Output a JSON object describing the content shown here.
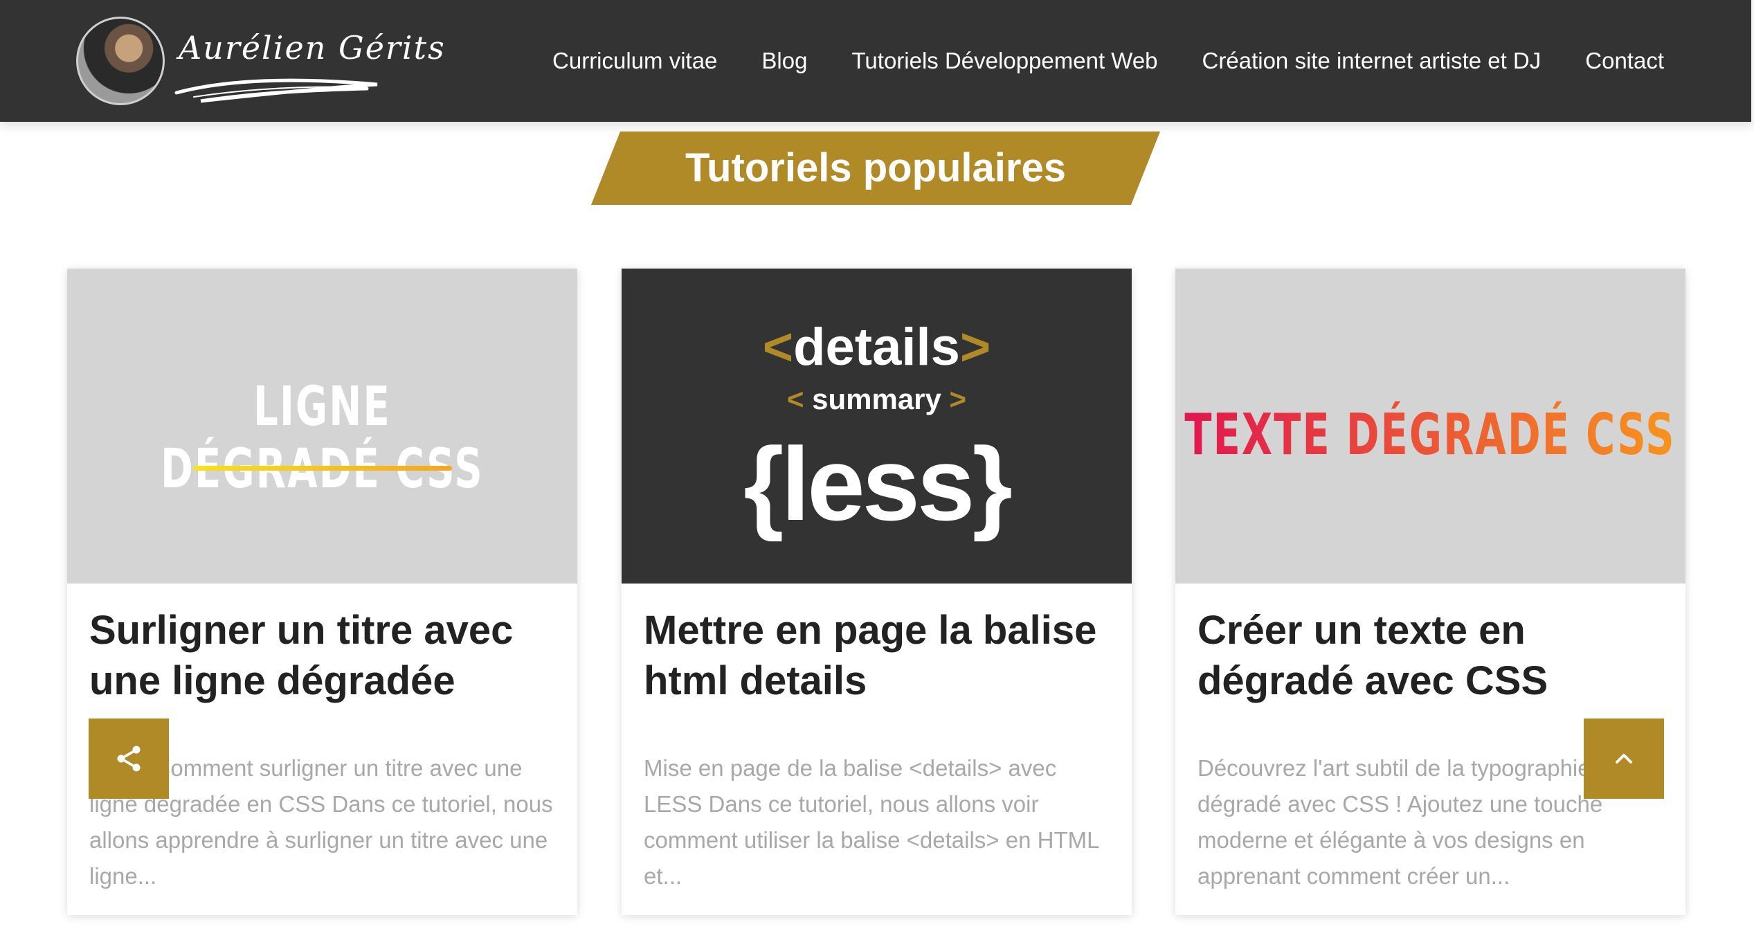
{
  "header": {
    "logo_text": "Aurélien Gérits",
    "nav": [
      "Curriculum vitae",
      "Blog",
      "Tutoriels Développement Web",
      "Création site internet artiste et DJ",
      "Contact"
    ]
  },
  "section": {
    "title": "Tutoriels populaires"
  },
  "cards": [
    {
      "thumb_text": "LIGNE DÉGRADÉ CSS",
      "title": "Surligner un titre avec une ligne dégradée",
      "excerpt": "Intro : Comment surligner un titre avec une ligne dégradée en CSS Dans ce tutoriel, nous allons apprendre à surligner un titre avec une ligne..."
    },
    {
      "thumb": {
        "lt": "<",
        "gt": ">",
        "tag1": "details",
        "tag2": "summary",
        "logo_open": "{",
        "logo_word": "less",
        "logo_close": "}"
      },
      "title": "Mettre en page la balise html details",
      "excerpt": "Mise en page de la balise <details> avec LESS Dans ce tutoriel, nous allons voir comment utiliser la balise <details> en HTML et..."
    },
    {
      "thumb_text": "TEXTE DÉGRADÉ CSS",
      "title": "Créer un texte en dégradé avec CSS",
      "excerpt": "Découvrez l'art subtil de la typographie en dégradé avec CSS ! Ajoutez une touche moderne et élégante à vos designs en apprenant comment créer un..."
    }
  ],
  "colors": {
    "header_bg": "#333333",
    "accent": "#b08a26",
    "thumb_gray": "#d4d4d4",
    "gradient_start": "#e0174f",
    "gradient_end": "#f7941e"
  },
  "icons": {
    "share": "share-icon",
    "scroll_top": "chevron-up-icon"
  }
}
